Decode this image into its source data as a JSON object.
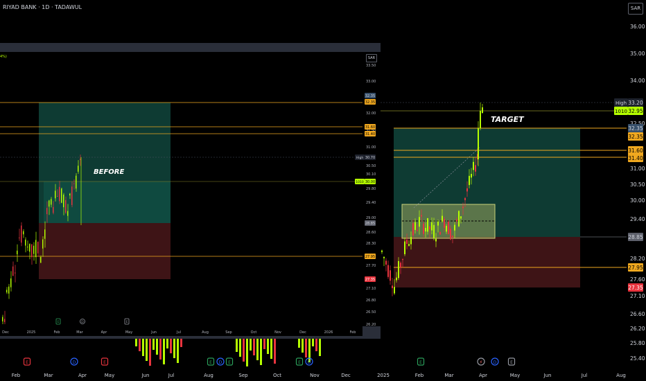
{
  "header": {
    "title": "RIYAD BANK · 1D · TADAWUL",
    "currency": "SAR"
  },
  "colors": {
    "background": "#000000",
    "up_candle": "#b5ff00",
    "down_candle": "#e8343e",
    "profit_zone": "#0e3b33",
    "loss_zone": "#3e1416",
    "level_line": "#f0a81f",
    "entry_box": "#9aa65c"
  },
  "chart_data": [
    {
      "type": "candlestick",
      "title": "RIYAD BANK · 1D · TADAWUL",
      "currency": "SAR",
      "y_axis_ticks": [
        "36.00",
        "35.00",
        "34.00",
        "32.50",
        "31.00",
        "30.50",
        "30.00",
        "29.40",
        "28.20",
        "27.60",
        "27.10",
        "26.60",
        "26.20",
        "25.80",
        "25.40"
      ],
      "x_axis_ticks": [
        "Feb",
        "Mar",
        "Apr",
        "May",
        "Jun",
        "Jul",
        "Aug",
        "Sep",
        "Oct",
        "Nov",
        "Dec",
        "2025",
        "Feb",
        "Mar",
        "Apr",
        "May",
        "Jun",
        "Jul",
        "Aug"
      ],
      "price_labels": [
        {
          "text": "High",
          "value": "33.20"
        },
        {
          "text": "1010",
          "value": "32.95"
        },
        {
          "value": "32.35"
        },
        {
          "value": "32.35"
        },
        {
          "value": "31.60"
        },
        {
          "value": "31.40"
        },
        {
          "value": "28.85"
        },
        {
          "value": "27.95"
        },
        {
          "value": "27.35"
        }
      ],
      "annotation": "TARGET",
      "event_markers": [
        "E",
        "D",
        "E",
        "E",
        "D",
        "E",
        "E",
        "D",
        "E",
        "D",
        "E"
      ],
      "series": [
        {
          "type": "ohlc",
          "x": [
            "2025-01-20",
            "2025-01-27",
            "2025-02-03",
            "2025-02-10",
            "2025-02-17",
            "2025-02-24",
            "2025-03-03",
            "2025-03-10",
            "2025-03-17",
            "2025-03-24",
            "2025-03-31"
          ],
          "close": [
            28.3,
            28.9,
            29.2,
            29.0,
            29.1,
            29.3,
            28.6,
            29.4,
            30.2,
            31.2,
            33.0
          ]
        }
      ],
      "trade": {
        "stop_loss": 27.35,
        "entry": 28.85,
        "take_profit": 32.35
      }
    },
    {
      "type": "candlestick",
      "currency": "SAR",
      "percent_label": "4%)",
      "y_axis_ticks": [
        "33.50",
        "33.00",
        "32.00",
        "31.50",
        "31.00",
        "30.50",
        "30.10",
        "29.80",
        "29.40",
        "29.00",
        "28.60",
        "28.30",
        "27.70",
        "27.10",
        "26.80",
        "26.50",
        "26.20"
      ],
      "x_axis_ticks": [
        "Dec",
        "2025",
        "Feb",
        "Mar",
        "Apr",
        "May",
        "Jun",
        "Jul",
        "Aug",
        "Sep",
        "Oct",
        "Nov",
        "Dec",
        "2026",
        "Feb"
      ],
      "price_labels": [
        {
          "value": "32.35"
        },
        {
          "value": "32.35"
        },
        {
          "value": "31.60"
        },
        {
          "value": "31.40"
        },
        {
          "text": "High",
          "value": "30.70"
        },
        {
          "text": "1010",
          "value": "30.00"
        },
        {
          "value": "28.85"
        },
        {
          "value": "27.95"
        },
        {
          "value": "27.35"
        }
      ],
      "annotation": "BEFORE",
      "event_markers": [
        "E",
        "D",
        "E"
      ],
      "trade": {
        "stop_loss": 27.35,
        "entry": 28.85,
        "take_profit": 32.35
      }
    }
  ]
}
